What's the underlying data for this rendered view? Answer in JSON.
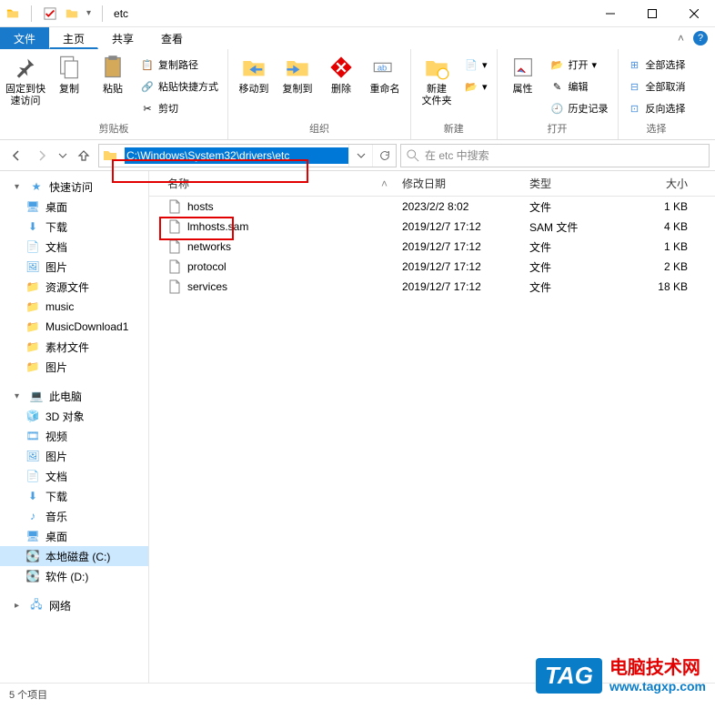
{
  "window": {
    "title": "etc"
  },
  "tabs": {
    "file": "文件",
    "home": "主页",
    "share": "共享",
    "view": "查看"
  },
  "ribbon": {
    "pin": "固定到快\n速访问",
    "copy": "复制",
    "paste": "粘贴",
    "copy_path": "复制路径",
    "paste_shortcut": "粘贴快捷方式",
    "cut": "剪切",
    "clipboard_group": "剪贴板",
    "move_to": "移动到",
    "copy_to": "复制到",
    "delete": "删除",
    "rename": "重命名",
    "organize_group": "组织",
    "new_folder": "新建\n文件夹",
    "new_group": "新建",
    "properties": "属性",
    "open_btn": "打开",
    "edit": "编辑",
    "history": "历史记录",
    "open_group": "打开",
    "select_all": "全部选择",
    "select_none": "全部取消",
    "invert": "反向选择",
    "select_group": "选择"
  },
  "address": "C:\\Windows\\System32\\drivers\\etc",
  "search": {
    "placeholder": "在 etc 中搜索"
  },
  "columns": {
    "name": "名称",
    "date": "修改日期",
    "type": "类型",
    "size": "大小"
  },
  "files": [
    {
      "name": "hosts",
      "date": "2023/2/2 8:02",
      "type": "文件",
      "size": "1 KB"
    },
    {
      "name": "lmhosts.sam",
      "date": "2019/12/7 17:12",
      "type": "SAM 文件",
      "size": "4 KB"
    },
    {
      "name": "networks",
      "date": "2019/12/7 17:12",
      "type": "文件",
      "size": "1 KB"
    },
    {
      "name": "protocol",
      "date": "2019/12/7 17:12",
      "type": "文件",
      "size": "2 KB"
    },
    {
      "name": "services",
      "date": "2019/12/7 17:12",
      "type": "文件",
      "size": "18 KB"
    }
  ],
  "sidebar": {
    "quick_access": "快速访问",
    "desktop": "桌面",
    "downloads": "下载",
    "documents": "文档",
    "pictures": "图片",
    "resources": "资源文件",
    "music": "music",
    "music_dl": "MusicDownload1",
    "materials": "素材文件",
    "pictures2": "图片",
    "this_pc": "此电脑",
    "3d": "3D 对象",
    "videos": "视频",
    "pictures3": "图片",
    "documents2": "文档",
    "downloads2": "下载",
    "music2": "音乐",
    "desktop2": "桌面",
    "disk_c": "本地磁盘 (C:)",
    "disk_d": "软件 (D:)",
    "network": "网络"
  },
  "status": "5 个项目",
  "overlay": {
    "tag": "TAG",
    "line1": "电脑技术网",
    "line2": "www.tagxp.com"
  }
}
